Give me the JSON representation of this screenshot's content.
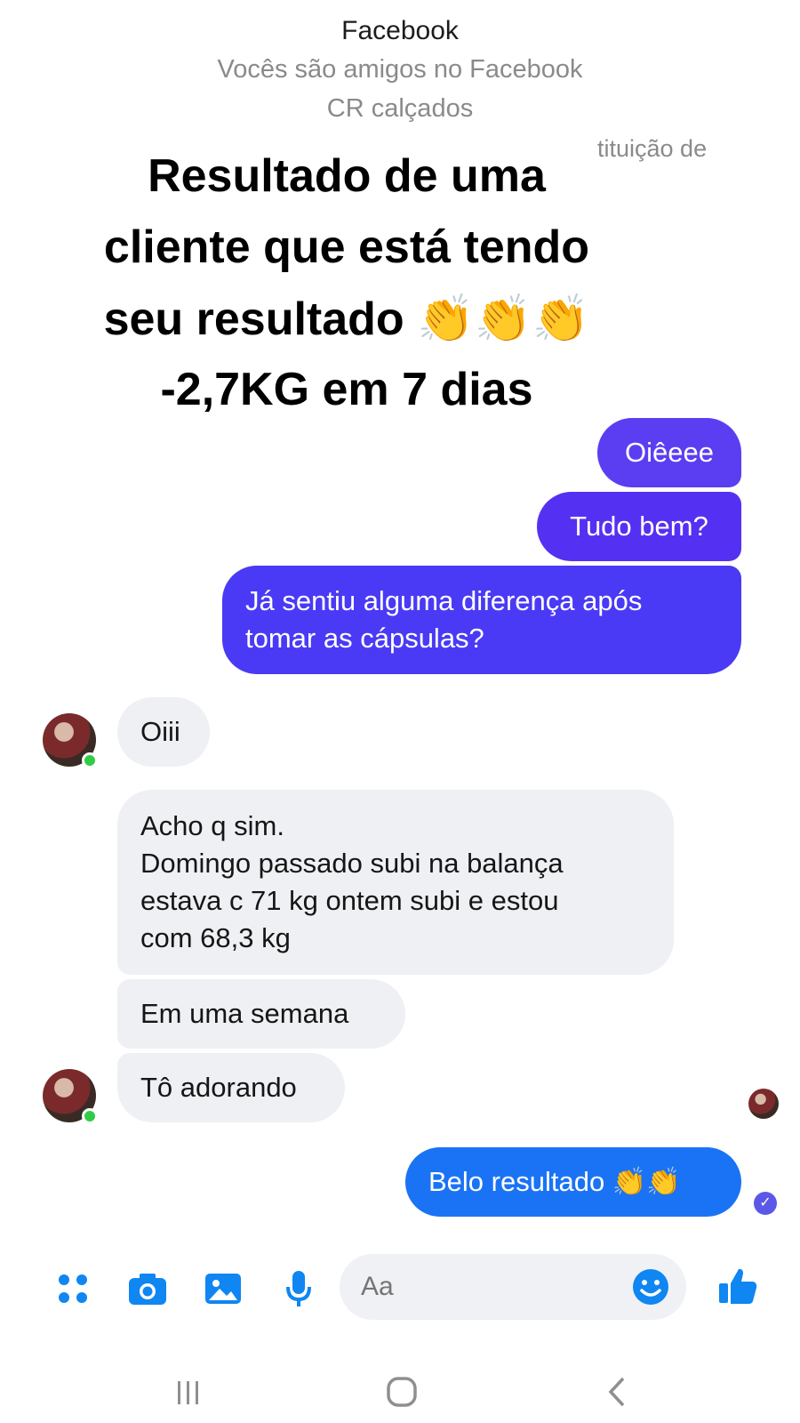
{
  "header": {
    "title": "Facebook",
    "subtitle": "Vocês são amigos no Facebook",
    "subtitle2": "CR calçados",
    "partial": "tituição de"
  },
  "overlay": {
    "line1": "Resultado de uma",
    "line2": "cliente que está tendo",
    "line3": "seu resultado 👏👏👏",
    "line4": "-2,7KG em 7 dias"
  },
  "messages": {
    "out1": "Oiêeee",
    "out2": "Tudo bem?",
    "out3_line1": "Já sentiu alguma diferença após",
    "out3_line2": "tomar as cápsulas?",
    "in1": "Oiii",
    "in2_line1": "Acho q sim.",
    "in2_line2": "Domingo passado subi na balança",
    "in2_line3": "estava c 71 kg ontem subi e estou",
    "in2_line4": "com 68,3 kg",
    "in3": "Em uma semana",
    "in4": "Tô adorando",
    "out4": "Belo resultado 👏👏"
  },
  "composer": {
    "placeholder": "Aa",
    "icons": [
      "menu-grid-icon",
      "camera-icon",
      "image-icon",
      "microphone-icon",
      "emoji-icon",
      "like-thumb-icon"
    ]
  },
  "colors": {
    "accent": "#0f86f2",
    "bubble_purple": "#5b3ef2",
    "bubble_blue": "#1a73f5",
    "incoming": "#eef0f3"
  }
}
